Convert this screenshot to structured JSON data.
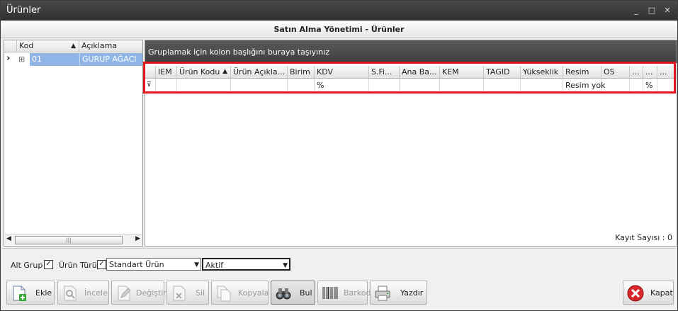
{
  "window": {
    "title": "Ürünler",
    "controls": [
      "_",
      "□",
      "✕"
    ]
  },
  "subtitle": "Satın Alma Yönetimi - Ürünler",
  "tree": {
    "columns": [
      "Kod",
      "Açıklama"
    ],
    "sort_indicator": "▲",
    "rows": [
      {
        "expand": "⊞",
        "kod": "01",
        "aciklama": "GURUP AĞACI"
      }
    ],
    "row_indicator": "›",
    "scroll": {
      "left": "◀",
      "thumb": "|||",
      "right": "▶"
    }
  },
  "grid": {
    "group_panel": "Gruplamak için kolon başlığını buraya taşıyınız",
    "columns": [
      "IEM",
      "Ürün Kodu",
      "Ürün Açıkla...",
      "Birim",
      "KDV",
      "S.Fi...",
      "Ana Ba...",
      "KEM",
      "TAGID",
      "Yükseklik",
      "Resim",
      "OS",
      "...",
      "..."
    ],
    "sort_indicator": "▲",
    "filter_row": {
      "kdv": "%",
      "resim": "Resim yok",
      "last": "%"
    },
    "filter_icon": "⊽",
    "record_count": "Kayıt Sayısı : 0"
  },
  "filters": {
    "alt_grup_label": "Alt Grup",
    "alt_grup_checked": "✓",
    "urun_turu_label": "Ürün Türü",
    "urun_turu_checked": "✓",
    "urun_turu_value": "Standart Ürün",
    "durum_value": "Aktif",
    "dropdown_arrow": "▼"
  },
  "toolbar": {
    "ekle": "Ekle",
    "incele": "İncele",
    "degistir": "Değiştir",
    "sil": "Sil",
    "kopyala": "Kopyala",
    "bul": "Bul",
    "barkod": "Barkod",
    "yazdir": "Yazdır",
    "kapat": "Kapat"
  },
  "colors": {
    "highlight": "#e3151d",
    "selection": "#8fb5e6",
    "titlebar": "#3a3a3a"
  }
}
